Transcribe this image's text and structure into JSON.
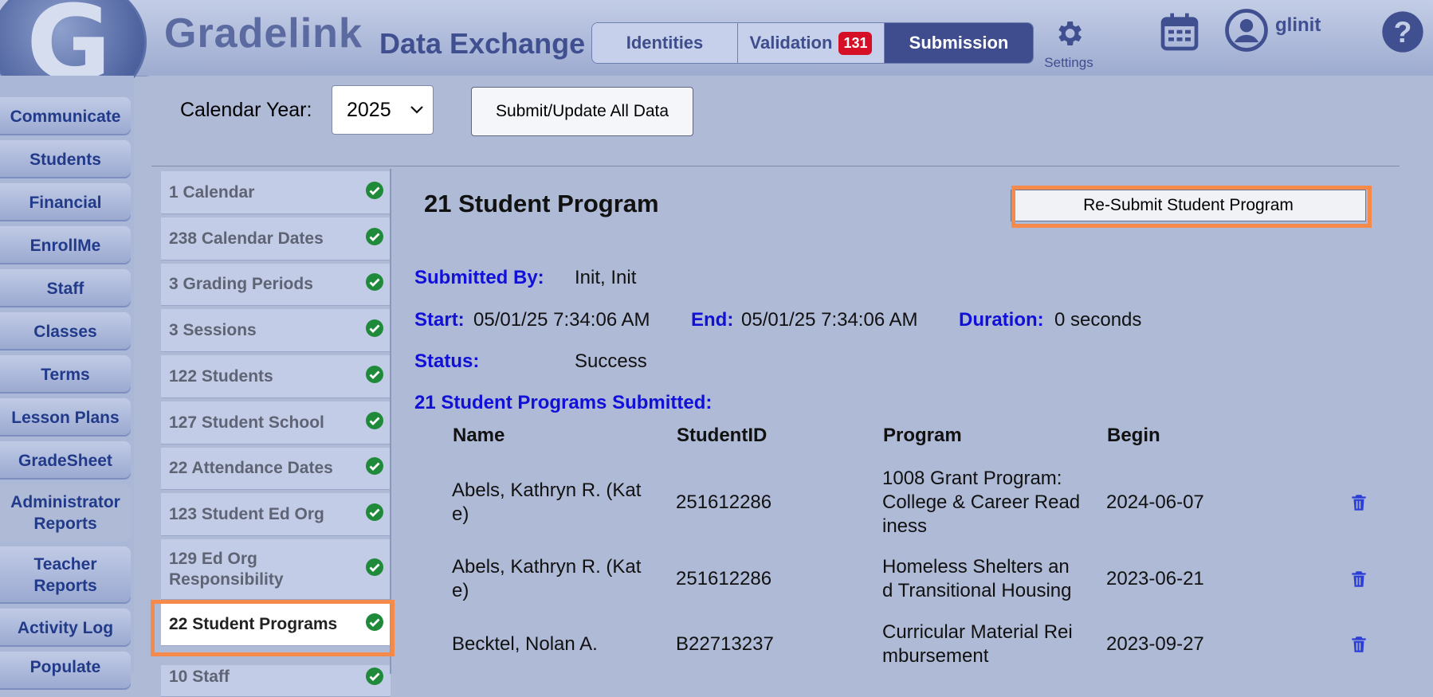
{
  "header": {
    "brand": "Gradelink",
    "logo_letter": "G",
    "app_title": "Data Exchange",
    "tabs": [
      {
        "label": "Identities"
      },
      {
        "label": "Validation",
        "badge": "131"
      },
      {
        "label": "Submission"
      }
    ],
    "settings_label": "Settings",
    "username": "glinit"
  },
  "nav": {
    "items": [
      {
        "label": "Communicate"
      },
      {
        "label": "Students"
      },
      {
        "label": "Financial"
      },
      {
        "label": "EnrollMe"
      },
      {
        "label": "Staff"
      },
      {
        "label": "Classes"
      },
      {
        "label": "Terms"
      },
      {
        "label": "Lesson Plans"
      },
      {
        "label": "GradeSheet"
      },
      {
        "label": "Administrator Reports"
      },
      {
        "label": "Teacher Reports"
      },
      {
        "label": "Activity Log"
      },
      {
        "label": "Populate"
      }
    ]
  },
  "toolbar": {
    "calendar_year_label": "Calendar Year:",
    "calendar_year_value": "2025",
    "submit_all_label": "Submit/Update All Data"
  },
  "steps": [
    {
      "label": "1 Calendar"
    },
    {
      "label": "238 Calendar Dates"
    },
    {
      "label": "3 Grading Periods"
    },
    {
      "label": "3 Sessions"
    },
    {
      "label": "122 Students"
    },
    {
      "label": "127 Student School"
    },
    {
      "label": "22 Attendance Dates"
    },
    {
      "label": "123 Student Ed Org"
    },
    {
      "label": "129 Ed Org Responsibility"
    },
    {
      "label": "22 Student Programs"
    },
    {
      "label": "10 Staff"
    }
  ],
  "detail": {
    "title": "21 Student Program",
    "resubmit_label": "Re-Submit Student Program",
    "submitted_by_label": "Submitted By:",
    "submitted_by_value": "Init, Init",
    "start_label": "Start:",
    "start_value": "05/01/25 7:34:06 AM",
    "end_label": "End:",
    "end_value": "05/01/25 7:34:06 AM",
    "duration_label": "Duration:",
    "duration_value": "0 seconds",
    "status_label": "Status:",
    "status_value": "Success",
    "section_title": "21 Student Programs Submitted:",
    "columns": [
      "Name",
      "StudentID",
      "Program",
      "Begin"
    ],
    "rows": [
      {
        "name": "Abels, Kathryn R. (Kat\ne)",
        "student_id": "251612286",
        "program": "1008 Grant Program:\nCollege & Career Read\niness",
        "begin": "2024-06-07"
      },
      {
        "name": "Abels, Kathryn R. (Kat\ne)",
        "student_id": "251612286",
        "program": "Homeless Shelters an\nd Transitional Housing",
        "begin": "2023-06-21"
      },
      {
        "name": "Becktel, Nolan A.",
        "student_id": "B22713237",
        "program": "Curricular Material Rei\nmbursement",
        "begin": "2023-09-27"
      }
    ]
  },
  "colors": {
    "accent_highlight": "#f58a4a",
    "label_blue": "#1010d8",
    "check_green": "#1f8a3a",
    "badge_red": "#d50f25"
  }
}
